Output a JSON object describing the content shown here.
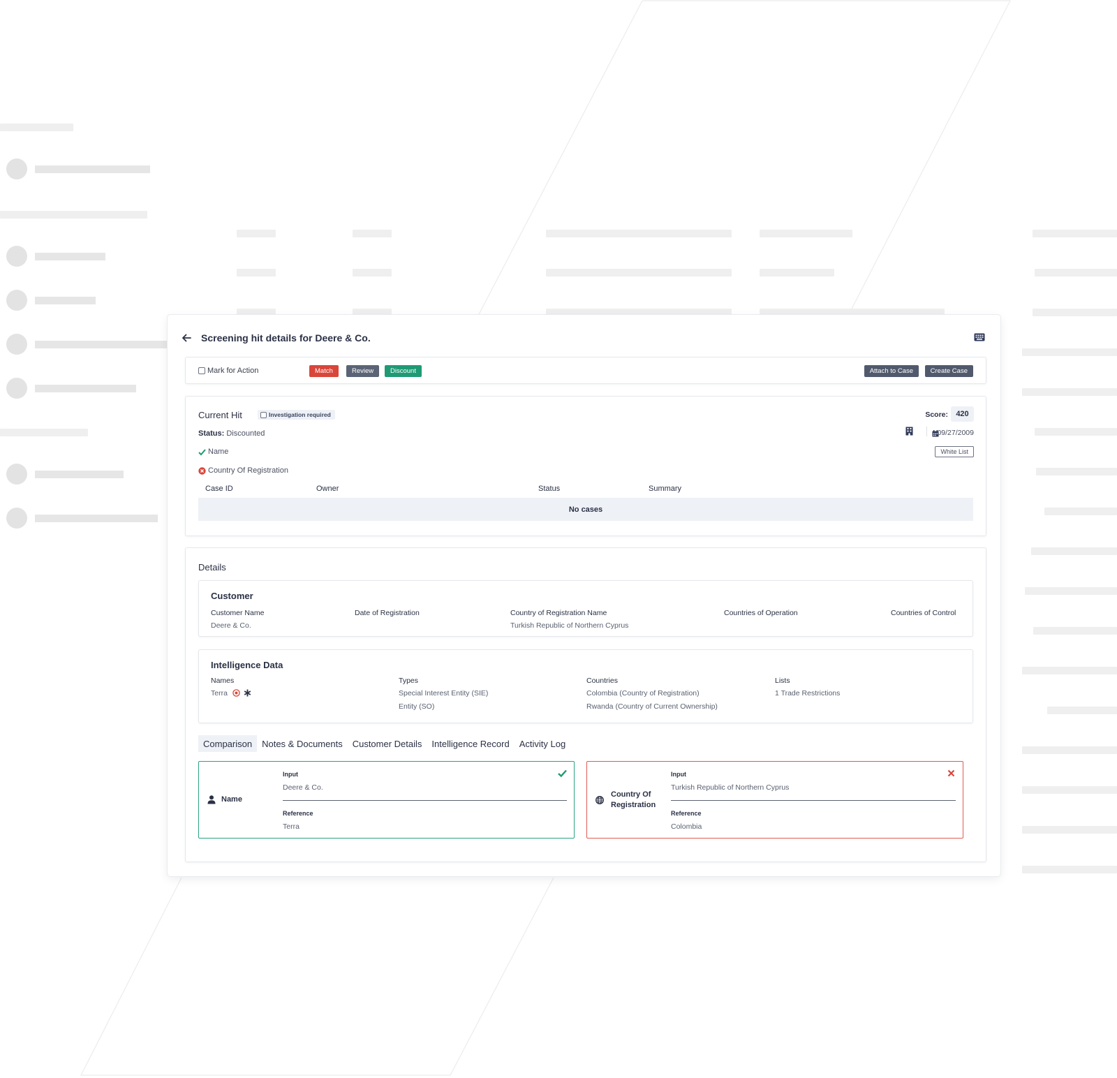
{
  "header": {
    "title": "Screening hit details for Deere & Co."
  },
  "action_bar": {
    "mark_label": "Mark for Action",
    "match_label": "Match",
    "review_label": "Review",
    "discount_label": "Discount",
    "attach_label": "Attach to Case",
    "create_label": "Create Case"
  },
  "current_hit": {
    "title": "Current Hit",
    "investigation_label": "Investigation required",
    "score_label": "Score:",
    "score": "420",
    "status_label": "Status:",
    "status_value": "Discounted",
    "date": "09/27/2009",
    "whitelist_label": "White List",
    "criteria": [
      {
        "label": "Name",
        "result": "match"
      },
      {
        "label": "Country Of Registration",
        "result": "mismatch"
      }
    ],
    "cases_table": {
      "headers": [
        "Case ID",
        "Owner",
        "Status",
        "Summary"
      ],
      "empty_text": "No cases"
    }
  },
  "details": {
    "title": "Details",
    "customer": {
      "title": "Customer",
      "columns": [
        {
          "label": "Customer Name",
          "value": "Deere & Co."
        },
        {
          "label": "Date of Registration",
          "value": ""
        },
        {
          "label": "Country of Registration Name",
          "value": "Turkish Republic of Northern Cyprus"
        },
        {
          "label": "Countries of Operation",
          "value": ""
        },
        {
          "label": "Countries of Control",
          "value": ""
        }
      ]
    },
    "intelligence": {
      "title": "Intelligence Data",
      "names_label": "Names",
      "names_value": "Terra",
      "types_label": "Types",
      "types_values": [
        "Special Interest Entity (SIE)",
        "Entity (SO)"
      ],
      "countries_label": "Countries",
      "countries_values": [
        "Colombia (Country of Registration)",
        "Rwanda (Country of Current Ownership)"
      ],
      "lists_label": "Lists",
      "lists_value": "1 Trade Restrictions"
    },
    "tabs": [
      {
        "label": "Comparison",
        "active": true
      },
      {
        "label": "Notes & Documents"
      },
      {
        "label": "Customer Details"
      },
      {
        "label": "Intelligence Record"
      },
      {
        "label": "Activity Log"
      }
    ],
    "comparison": [
      {
        "field_label": "Name",
        "input_label": "Input",
        "input_value": "Deere & Co.",
        "reference_label": "Reference",
        "reference_value": "Terra",
        "result": "match"
      },
      {
        "field_label_line1": "Country Of",
        "field_label_line2": "Registration",
        "input_label": "Input",
        "input_value": "Turkish Republic of Northern Cyprus",
        "reference_label": "Reference",
        "reference_value": "Colombia",
        "result": "mismatch"
      }
    ]
  },
  "colors": {
    "match": "#1f9a74",
    "mismatch": "#d9463a",
    "review": "#5b6476",
    "dark_button": "#515a6d",
    "text": "#2b3145",
    "muted_fill": "#eef1f6"
  },
  "icons": [
    "back-arrow-icon",
    "keyboard-icon",
    "building-icon",
    "calendar-icon",
    "check-icon",
    "error-circle-icon",
    "target-icon",
    "asterisk-icon",
    "user-icon",
    "globe-icon",
    "close-icon"
  ]
}
